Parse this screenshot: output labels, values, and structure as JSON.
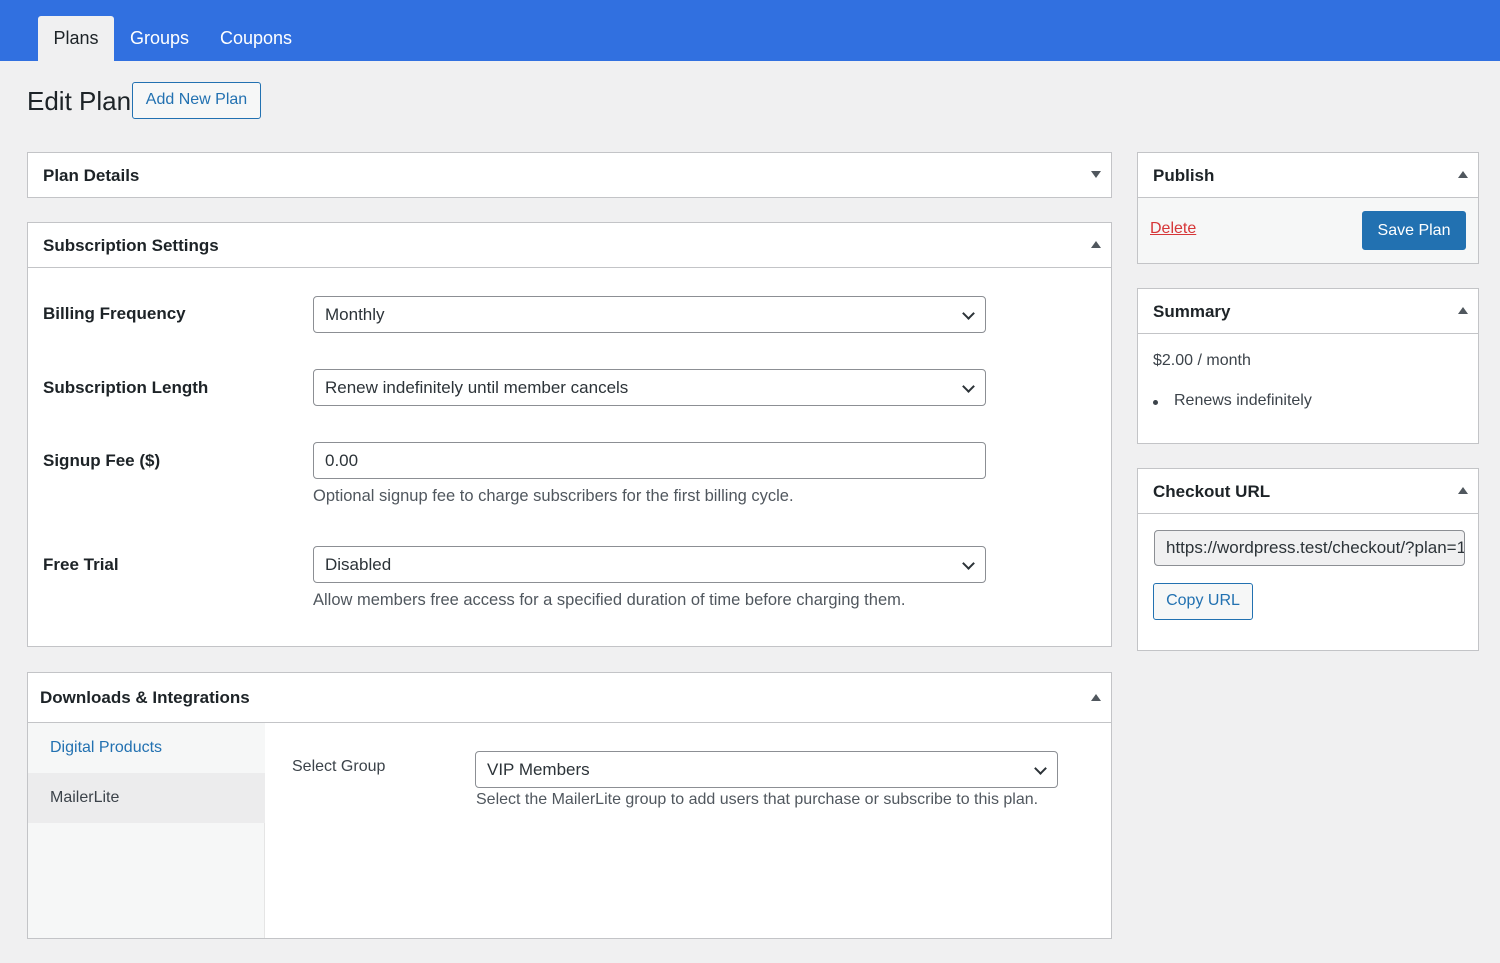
{
  "nav": {
    "tabs": [
      {
        "label": "Plans",
        "active": true
      },
      {
        "label": "Groups",
        "active": false
      },
      {
        "label": "Coupons",
        "active": false
      }
    ]
  },
  "header": {
    "title": "Edit Plan",
    "add_new_label": "Add New Plan"
  },
  "plan_details": {
    "title": "Plan Details"
  },
  "subscription": {
    "title": "Subscription Settings",
    "billing_frequency": {
      "label": "Billing Frequency",
      "value": "Monthly"
    },
    "subscription_length": {
      "label": "Subscription Length",
      "value": "Renew indefinitely until member cancels"
    },
    "signup_fee": {
      "label": "Signup Fee ($)",
      "value": "0.00",
      "help": "Optional signup fee to charge subscribers for the first billing cycle."
    },
    "free_trial": {
      "label": "Free Trial",
      "value": "Disabled",
      "help": "Allow members free access for a specified duration of time before charging them."
    }
  },
  "integrations": {
    "title": "Downloads & Integrations",
    "tabs": [
      "Digital Products",
      "MailerLite"
    ],
    "select_group_label": "Select Group",
    "select_group_value": "VIP Members",
    "select_group_help": "Select the MailerLite group to add users that purchase or subscribe to this plan."
  },
  "publish": {
    "title": "Publish",
    "delete_label": "Delete",
    "save_label": "Save Plan"
  },
  "summary": {
    "title": "Summary",
    "price": "$2.00 / month",
    "items": [
      "Renews indefinitely"
    ]
  },
  "checkout": {
    "title": "Checkout URL",
    "url": "https://wordpress.test/checkout/?plan=1",
    "copy_label": "Copy URL"
  },
  "colors": {
    "topbar": "#3170e0",
    "primary": "#2271b1",
    "danger": "#d63638"
  }
}
